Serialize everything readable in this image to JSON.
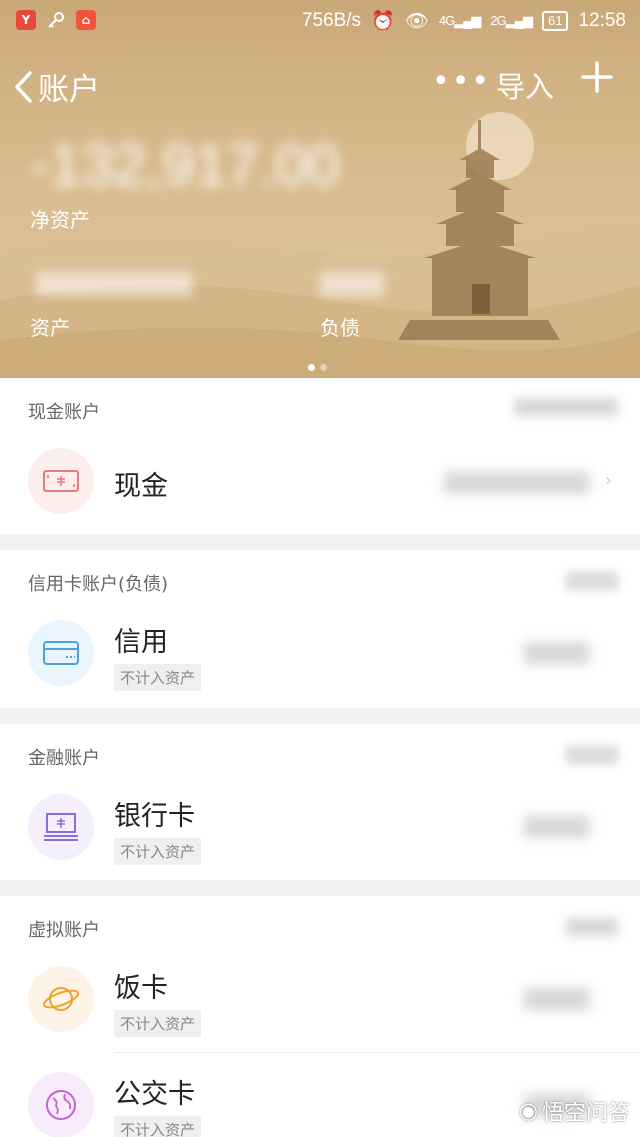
{
  "status_bar": {
    "net_speed": "756B/s",
    "signal_1": "4G",
    "signal_2": "2G",
    "battery": "61",
    "time": "12:58"
  },
  "topbar": {
    "title": "账户",
    "more": "•••",
    "import_label": "导入"
  },
  "summary": {
    "net_assets_value": "-132,917.00",
    "net_assets_label": "净资产",
    "assets_label": "资产",
    "debt_label": "负债"
  },
  "sections": [
    {
      "title": "现金账户",
      "items": [
        {
          "name": "现金",
          "tag": ""
        }
      ]
    },
    {
      "title": "信用卡账户(负债)",
      "items": [
        {
          "name": "信用",
          "tag": "不计入资产"
        }
      ]
    },
    {
      "title": "金融账户",
      "items": [
        {
          "name": "银行卡",
          "tag": "不计入资产"
        }
      ]
    },
    {
      "title": "虚拟账户",
      "items": [
        {
          "name": "饭卡",
          "tag": "不计入资产"
        },
        {
          "name": "公交卡",
          "tag": "不计入资产"
        }
      ]
    }
  ],
  "watermark": "悟空问答",
  "colors": {
    "header_bg": "#d4b688",
    "cash_icon": "#e97a7a",
    "credit_icon": "#4aa3df",
    "bank_icon": "#8b6fd6",
    "meal_icon": "#f0a12a",
    "bus_icon": "#c75fd8"
  }
}
